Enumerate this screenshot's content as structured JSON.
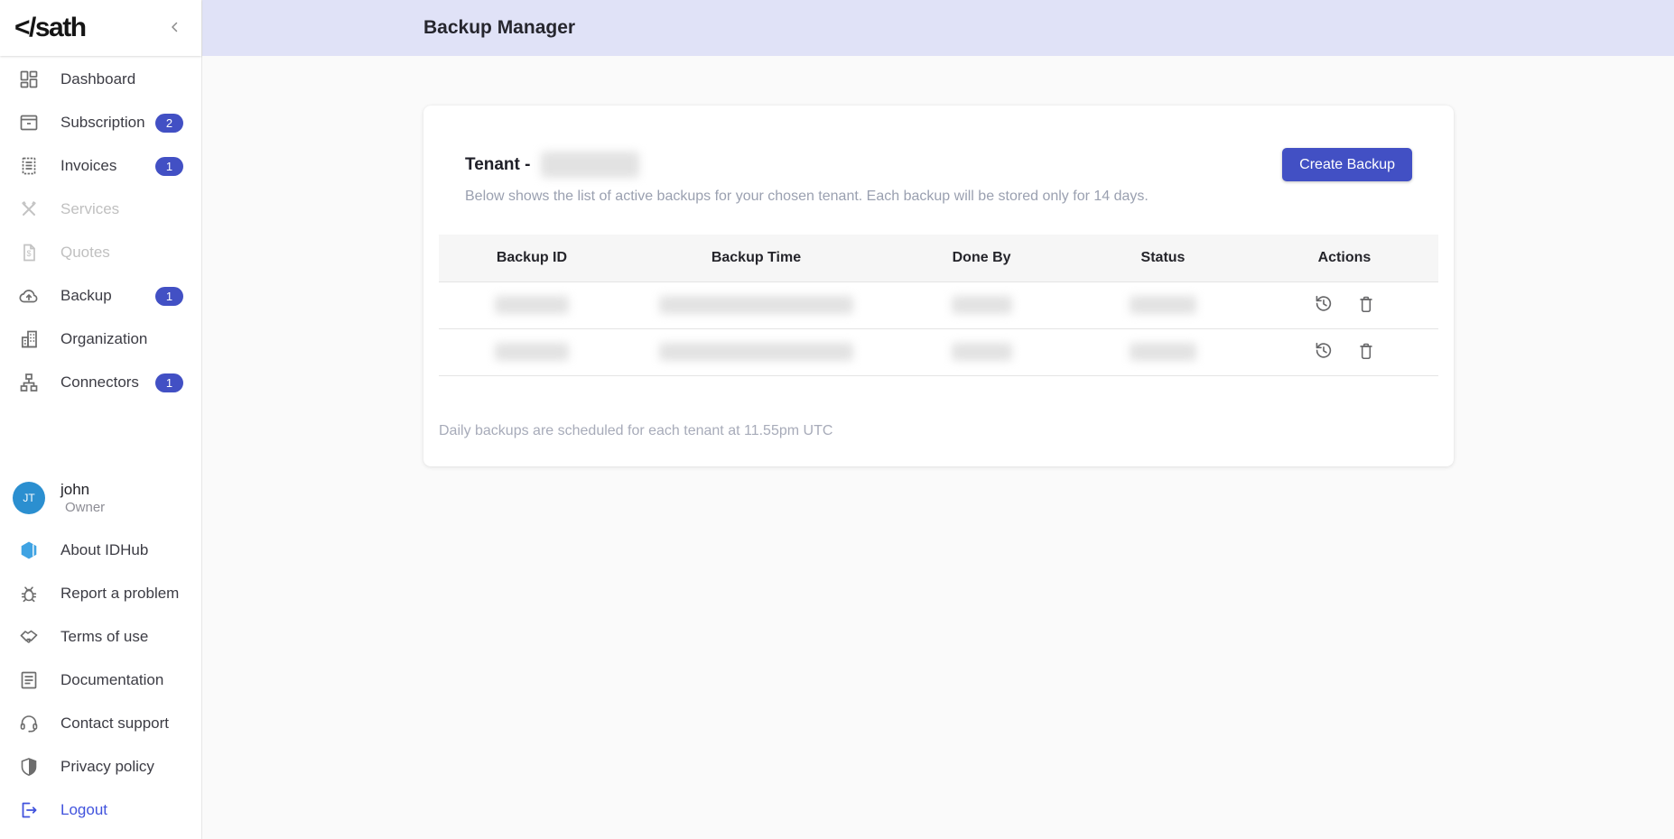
{
  "colors": {
    "accent": "#4250c4",
    "topbar_bg": "#e0e2f7",
    "avatar_bg": "#2b8fd0",
    "hexagon_blue": "#3fa3e3",
    "logout_blue": "#4153dd"
  },
  "brand": {
    "logo_text": "</sath"
  },
  "topbar": {
    "title": "Backup Manager"
  },
  "sidebar": {
    "items": [
      {
        "label": "Dashboard",
        "icon": "dashboard-icon"
      },
      {
        "label": "Subscription",
        "icon": "subscription-icon",
        "badge": "2"
      },
      {
        "label": "Invoices",
        "icon": "invoices-icon",
        "badge": "1"
      },
      {
        "label": "Services",
        "icon": "services-icon",
        "disabled": true
      },
      {
        "label": "Quotes",
        "icon": "quotes-icon",
        "disabled": true
      },
      {
        "label": "Backup",
        "icon": "backup-icon",
        "badge": "1"
      },
      {
        "label": "Organization",
        "icon": "organization-icon"
      },
      {
        "label": "Connectors",
        "icon": "connectors-icon",
        "badge": "1"
      }
    ],
    "user": {
      "initials": "JT",
      "name": "john",
      "role": "Owner"
    },
    "footer_items": [
      {
        "label": "About IDHub",
        "icon": "idhub-hexagon-icon"
      },
      {
        "label": "Report a problem",
        "icon": "bug-icon"
      },
      {
        "label": "Terms of use",
        "icon": "handshake-icon"
      },
      {
        "label": "Documentation",
        "icon": "document-icon"
      },
      {
        "label": "Contact support",
        "icon": "headset-icon"
      },
      {
        "label": "Privacy policy",
        "icon": "shield-icon"
      },
      {
        "label": "Logout",
        "icon": "logout-icon"
      }
    ]
  },
  "main": {
    "card": {
      "tenant_label": "Tenant -",
      "tenant_name_redacted": true,
      "description": "Below shows the list of active backups for your chosen tenant. Each backup will be stored only for 14 days.",
      "create_button_label": "Create Backup",
      "table": {
        "headers": [
          "Backup ID",
          "Backup Time",
          "Done By",
          "Status",
          "Actions"
        ],
        "rows": [
          {
            "redacted": true,
            "actions": [
              "restore-icon",
              "delete-icon"
            ]
          },
          {
            "redacted": true,
            "actions": [
              "restore-icon",
              "delete-icon"
            ]
          }
        ]
      },
      "footer_note": "Daily backups are scheduled for each tenant at 11.55pm UTC"
    }
  }
}
